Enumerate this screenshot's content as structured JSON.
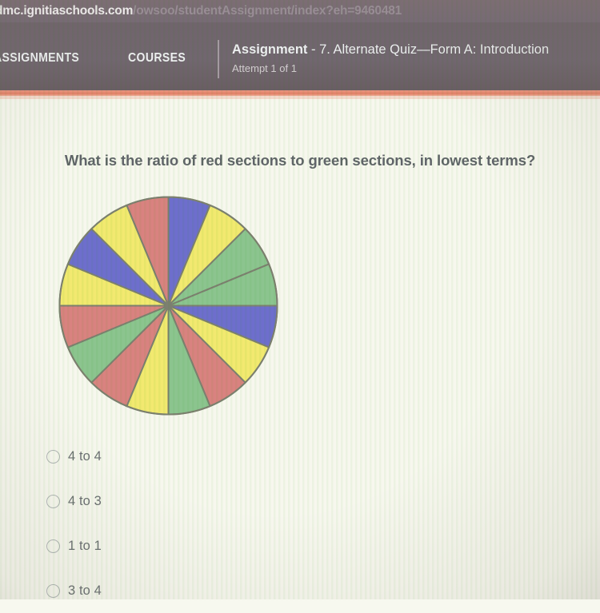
{
  "browser": {
    "url_host": "dmc.ignitiaschools.com",
    "url_path": "/owsoo/studentAssignment/index?eh=9460481"
  },
  "header": {
    "nav": [
      {
        "label": "ASSIGNMENTS",
        "name": "nav-assignments"
      },
      {
        "label": "COURSES",
        "name": "nav-courses"
      }
    ],
    "assignment_label": "Assignment",
    "assignment_title": " - 7. Alternate Quiz—Form A: Introduction",
    "attempt": "Attempt 1 of 1",
    "accent_color": "#df6f52",
    "bar_color": "#5e525c"
  },
  "question": {
    "text": "What is the ratio of red sections to green sections, in lowest terms?"
  },
  "chart_data": {
    "type": "pie",
    "title": "",
    "total_sections": 16,
    "equal_slices": true,
    "slice_angle_degrees": 22.5,
    "start_angle_degrees": 0,
    "direction": "clockwise",
    "center": [
      138.5,
      138.5
    ],
    "radius": 136,
    "stroke_color": "#6b6f5c",
    "stroke_width": 2,
    "palette": {
      "red": "#d4726f",
      "green": "#7cbd80",
      "yellow": "#f0e75c",
      "blue": "#5a5bc6"
    },
    "categories": [
      "red",
      "green",
      "yellow",
      "blue"
    ],
    "values": [
      4,
      4,
      4,
      4
    ],
    "slices": [
      {
        "index": 1,
        "color_name": "blue",
        "color": "#5a5bc6"
      },
      {
        "index": 2,
        "color_name": "yellow",
        "color": "#f0e75c"
      },
      {
        "index": 3,
        "color_name": "green",
        "color": "#7cbd80"
      },
      {
        "index": 4,
        "color_name": "green",
        "color": "#7cbd80"
      },
      {
        "index": 5,
        "color_name": "blue",
        "color": "#5a5bc6"
      },
      {
        "index": 6,
        "color_name": "yellow",
        "color": "#f0e75c"
      },
      {
        "index": 7,
        "color_name": "red",
        "color": "#d4726f"
      },
      {
        "index": 8,
        "color_name": "green",
        "color": "#7cbd80"
      },
      {
        "index": 9,
        "color_name": "yellow",
        "color": "#f0e75c"
      },
      {
        "index": 10,
        "color_name": "red",
        "color": "#d4726f"
      },
      {
        "index": 11,
        "color_name": "green",
        "color": "#7cbd80"
      },
      {
        "index": 12,
        "color_name": "red",
        "color": "#d4726f"
      },
      {
        "index": 13,
        "color_name": "yellow",
        "color": "#f0e75c"
      },
      {
        "index": 14,
        "color_name": "blue",
        "color": "#5a5bc6"
      },
      {
        "index": 15,
        "color_name": "yellow",
        "color": "#f0e75c"
      },
      {
        "index": 16,
        "color_name": "red",
        "color": "#d4726f"
      }
    ]
  },
  "options": [
    {
      "label": "4 to 4",
      "selected": false
    },
    {
      "label": "4 to 3",
      "selected": false
    },
    {
      "label": "1 to 1",
      "selected": false
    },
    {
      "label": "3 to 4",
      "selected": false
    }
  ]
}
